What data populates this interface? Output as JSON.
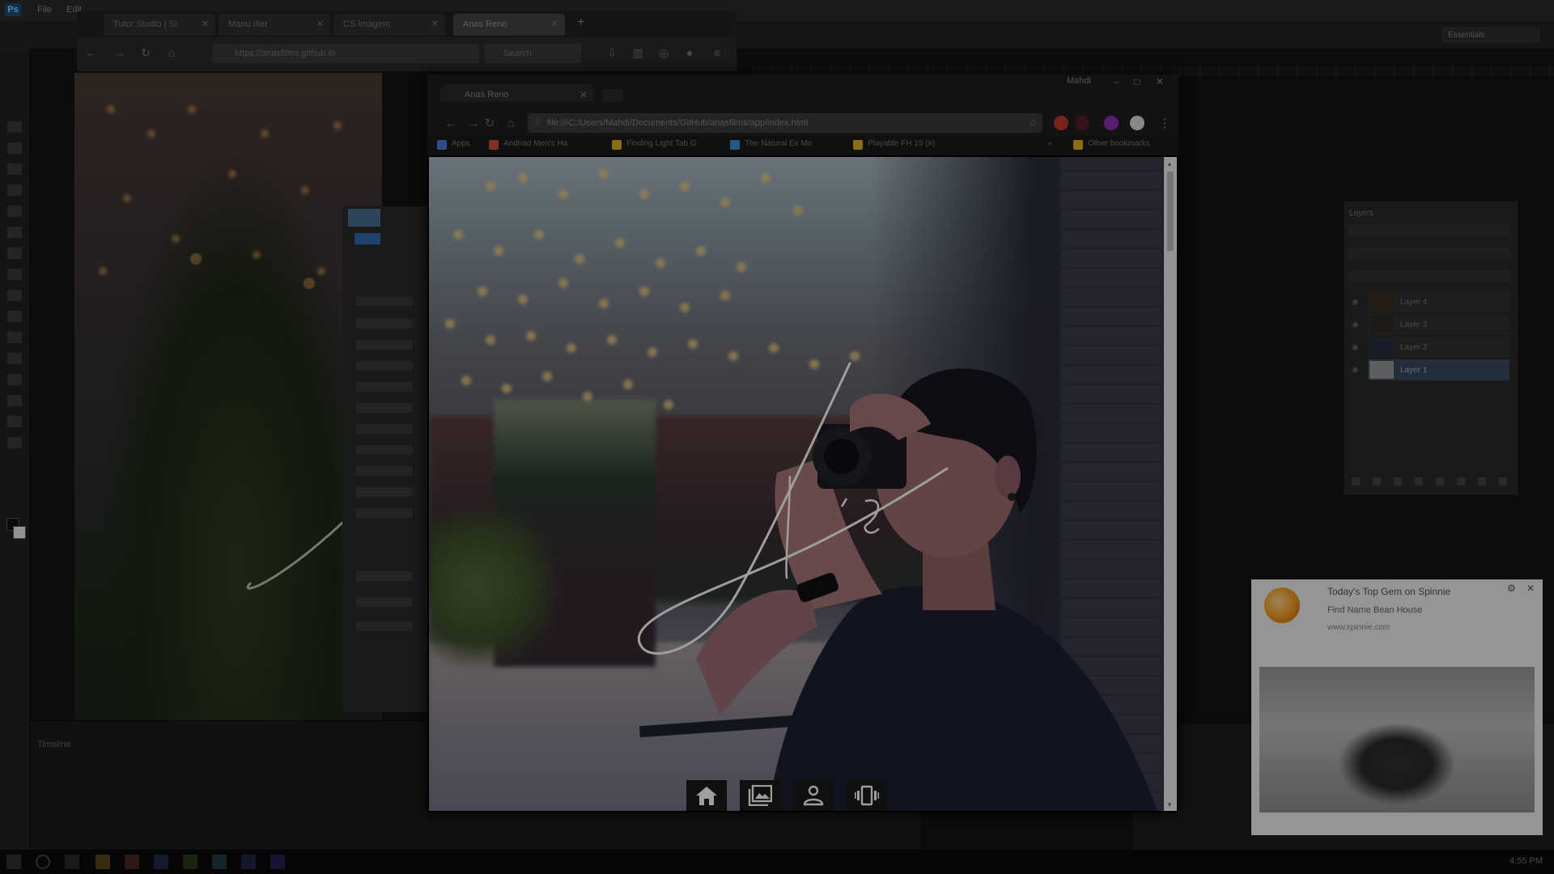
{
  "background_app": {
    "logo": "Ps",
    "menu": [
      "File",
      "Edit"
    ],
    "workspace": "Essentials",
    "timeline_label": "Timeline",
    "dock_icons": [
      "home-icon",
      "gallery-icon"
    ]
  },
  "back_browser": {
    "tabs": [
      {
        "label": "Tutor Studio | SI"
      },
      {
        "label": "Manu Ilter"
      },
      {
        "label": "CS Imagem"
      },
      {
        "label": "Anas Reno"
      }
    ],
    "address": "https://anasfilms.github.io",
    "search_placeholder": "Search"
  },
  "chrome": {
    "tab_title": "Anas Reno",
    "user_label": "Mahdi",
    "address": "file:///C:/Users/Mahdi/Documents/GitHub/anasfilms/app/index.html",
    "bookmarks": [
      {
        "label": "Apps",
        "color": "#4c7dd8"
      },
      {
        "label": "Android Men's Ha",
        "color": "#d04b3a"
      },
      {
        "label": "Finding Light Tab G",
        "color": "#e0b020"
      },
      {
        "label": "The Natural Ex Mo",
        "color": "#3a8fd8"
      },
      {
        "label": "Playable FH 15 (#)",
        "color": "#e0b020"
      },
      {
        "label": "Other bookmarks",
        "color": "#e0b020"
      }
    ],
    "extensions": [
      {
        "name": "opera-icon",
        "color": "#c0392b"
      },
      {
        "name": "ext-dark-icon",
        "color": "#5a1f2a"
      },
      {
        "name": "ext-purple-icon",
        "color": "#8e2fb8"
      },
      {
        "name": "ext-white-icon",
        "color": "#dddddd"
      }
    ]
  },
  "site": {
    "signature_alt": "An",
    "nav": [
      {
        "name": "home",
        "icon": "home-icon"
      },
      {
        "name": "gallery",
        "icon": "gallery-icon"
      },
      {
        "name": "about",
        "icon": "person-icon"
      },
      {
        "name": "contact",
        "icon": "phone-vibrate-icon"
      }
    ]
  },
  "layers_panel": {
    "title": "Layers",
    "layers": [
      "Layer 4",
      "Layer 3",
      "Layer 2",
      "Layer 1"
    ]
  },
  "notification": {
    "title": "Today's Top Gem on Spinnie",
    "subtitle": "Find Name Bean House",
    "site": "www.spinnie.com"
  },
  "taskbar": {
    "clock": "4:55 PM"
  }
}
